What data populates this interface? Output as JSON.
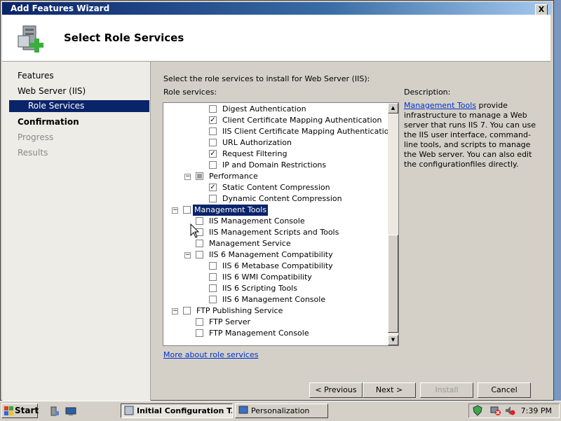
{
  "window": {
    "title": "Add Features Wizard",
    "close_glyph": "X"
  },
  "header": {
    "title": "Select Role Services"
  },
  "nav": [
    {
      "label": "Features",
      "state": "normal"
    },
    {
      "label": "Web Server (IIS)",
      "state": "normal"
    },
    {
      "label": "Role Services",
      "state": "selected"
    },
    {
      "label": "Confirmation",
      "state": "bold"
    },
    {
      "label": "Progress",
      "state": "disabled"
    },
    {
      "label": "Results",
      "state": "disabled"
    }
  ],
  "main": {
    "instruction": "Select the role services to install for Web Server (IIS):",
    "role_services_label": "Role services:",
    "description_label": "Description:",
    "description_link": "Management Tools",
    "description_text": " provide infrastructure to manage a Web server that runs IIS 7. You can use the IIS user interface, command-line tools, and scripts to manage the Web server. You can also edit the configurationfiles directly.",
    "more_link": "More about role services"
  },
  "tree": [
    {
      "label": "Digest Authentication",
      "level": 2,
      "checked": false
    },
    {
      "label": "Client Certificate Mapping Authentication",
      "level": 2,
      "checked": true
    },
    {
      "label": "IIS Client Certificate Mapping Authentication",
      "level": 2,
      "checked": false
    },
    {
      "label": "URL Authorization",
      "level": 2,
      "checked": false
    },
    {
      "label": "Request Filtering",
      "level": 2,
      "checked": true
    },
    {
      "label": "IP and Domain Restrictions",
      "level": 2,
      "checked": false
    },
    {
      "label": "Performance",
      "level": 1,
      "checked": "partial",
      "expander": "−"
    },
    {
      "label": "Static Content Compression",
      "level": 2,
      "checked": true
    },
    {
      "label": "Dynamic Content Compression",
      "level": 2,
      "checked": false
    },
    {
      "label": "Management Tools",
      "level": 0,
      "checked": false,
      "expander": "−",
      "highlighted": true
    },
    {
      "label": "IIS Management Console",
      "level": 1,
      "checked": false
    },
    {
      "label": "IIS Management Scripts and Tools",
      "level": 1,
      "checked": false
    },
    {
      "label": "Management Service",
      "level": 1,
      "checked": false
    },
    {
      "label": "IIS 6 Management Compatibility",
      "level": 1,
      "checked": false,
      "expander": "−"
    },
    {
      "label": "IIS 6 Metabase Compatibility",
      "level": 2,
      "checked": false
    },
    {
      "label": "IIS 6 WMI Compatibility",
      "level": 2,
      "checked": false
    },
    {
      "label": "IIS 6 Scripting Tools",
      "level": 2,
      "checked": false
    },
    {
      "label": "IIS 6 Management Console",
      "level": 2,
      "checked": false
    },
    {
      "label": "FTP Publishing Service",
      "level": 0,
      "checked": false,
      "expander": "−"
    },
    {
      "label": "FTP Server",
      "level": 1,
      "checked": false
    },
    {
      "label": "FTP Management Console",
      "level": 1,
      "checked": false
    }
  ],
  "buttons": {
    "previous": "< Previous",
    "next": "Next >",
    "install": "Install",
    "cancel": "Cancel"
  },
  "taskbar": {
    "start": "Start",
    "tasks": [
      "Initial Configuration T...",
      "Personalization"
    ],
    "clock": "7:39 PM"
  }
}
